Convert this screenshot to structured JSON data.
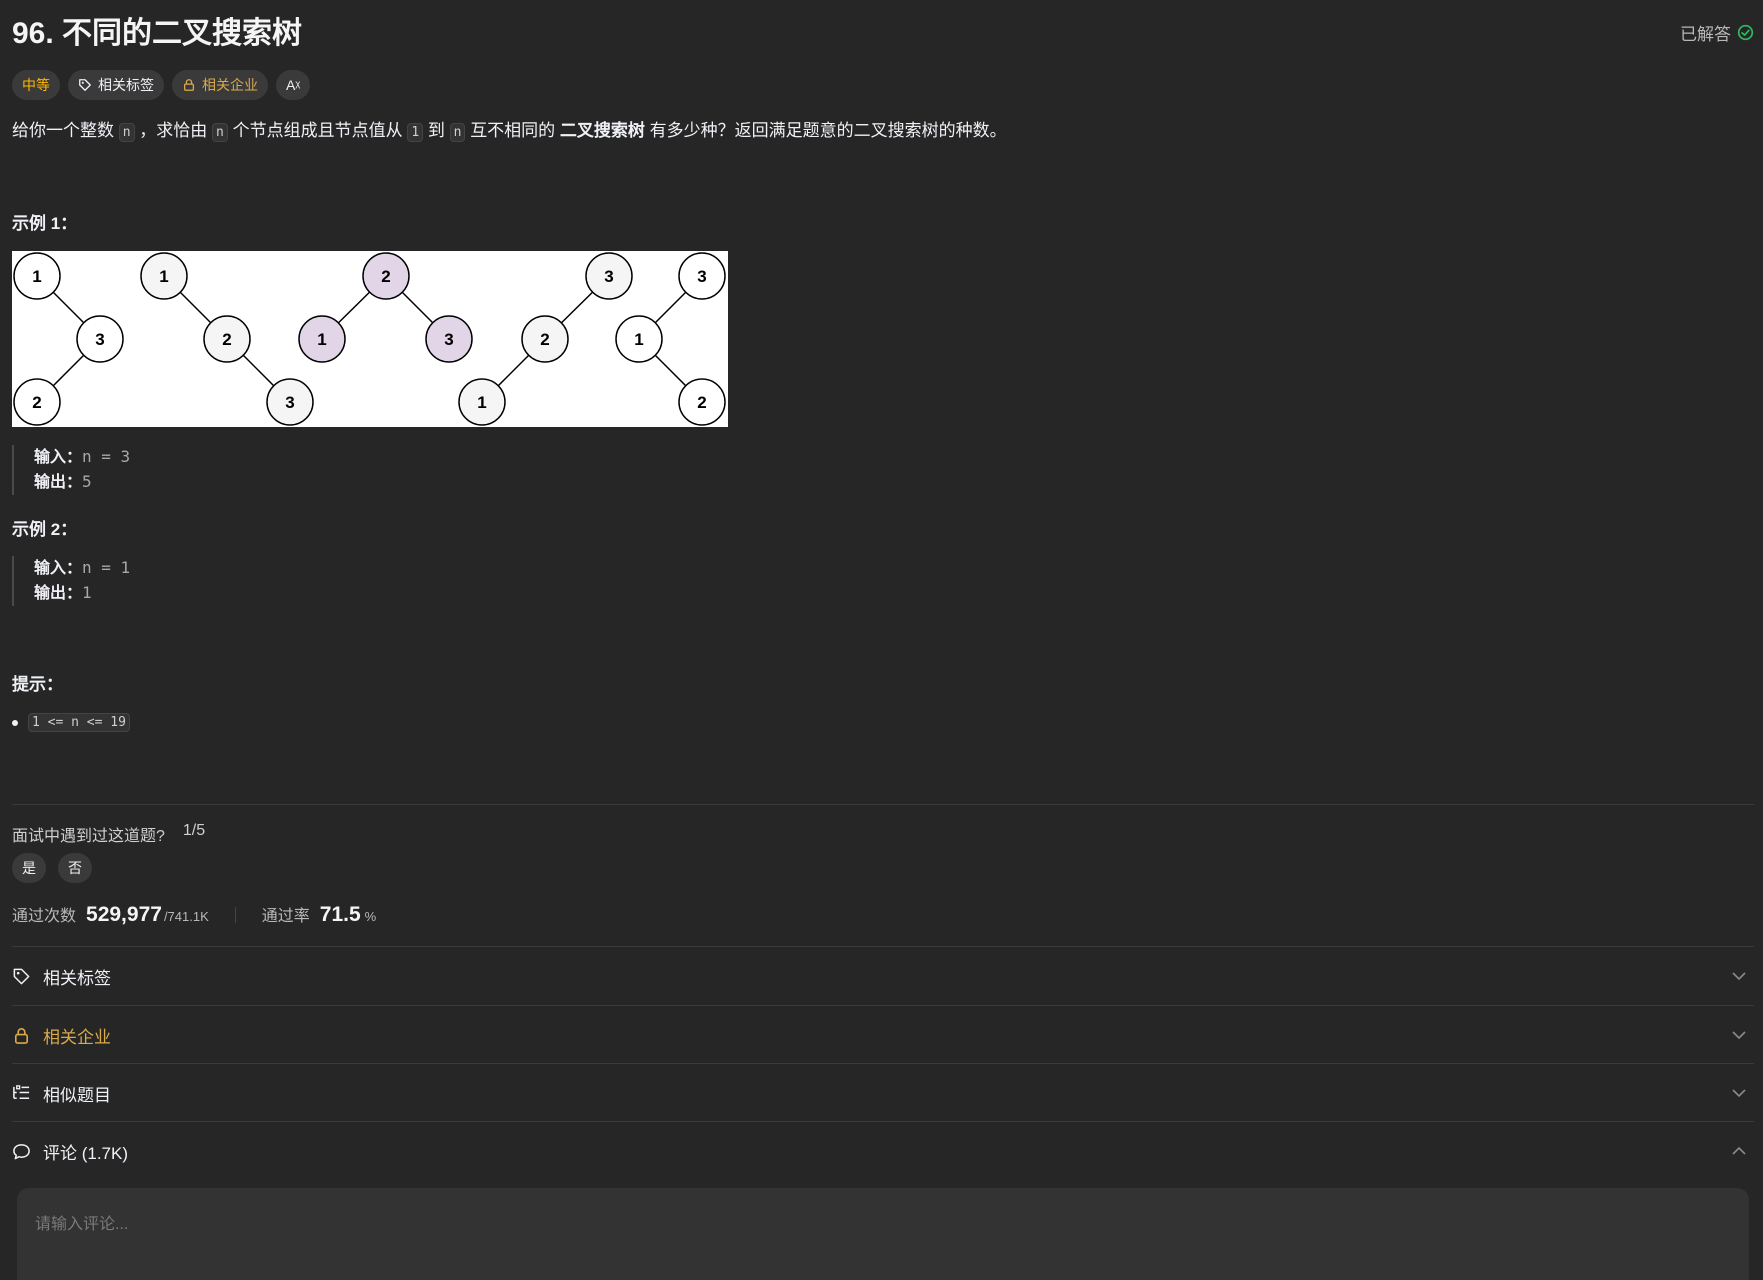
{
  "problem": {
    "title": "96. 不同的二叉搜索树",
    "status": "已解答"
  },
  "tags": {
    "difficulty": "中等",
    "related_tags": "相关标签",
    "related_companies": "相关企业",
    "translate": "Aᵡ"
  },
  "description": {
    "p1": "给你一个整数",
    "code_n": "n",
    "p2": "，求恰由",
    "p3": "个节点组成且节点值从",
    "code_1": "1",
    "p4": "到",
    "p5": "互不相同的",
    "bold": "二叉搜索树",
    "p6": "有多少种？返回满足题意的二叉搜索树的种数。"
  },
  "example1": {
    "title": "示例 1：",
    "input_label": "输入：",
    "input_value": "n = 3",
    "output_label": "输出：",
    "output_value": "5",
    "trees": [
      [
        "1",
        "3",
        "2"
      ],
      [
        "1",
        "2",
        "3"
      ],
      [
        "2",
        "1",
        "3"
      ],
      [
        "3",
        "2",
        "1"
      ],
      [
        "3",
        "1",
        "2"
      ]
    ]
  },
  "example2": {
    "title": "示例 2：",
    "input_label": "输入：",
    "input_value": "n = 1",
    "output_label": "输出：",
    "output_value": "1"
  },
  "hints": {
    "title": "提示：",
    "constraint": "1 <= n <= 19"
  },
  "interview": {
    "question": "面试中遇到过这道题?",
    "count": "1/5",
    "yes": "是",
    "no": "否"
  },
  "stats": {
    "accepted_label": "通过次数",
    "accepted_value": "529,977",
    "submissions": "/741.1K",
    "rate_label": "通过率",
    "rate_value": "71.5",
    "rate_unit": "%"
  },
  "sections": {
    "related_tags": "相关标签",
    "related_companies": "相关企业",
    "similar": "相似题目",
    "comments": "评论 (1.7K)"
  },
  "comment": {
    "placeholder": "请输入评论..."
  },
  "colors": {
    "background": "#262626",
    "difficulty": "#ffb800",
    "company": "#d9a94a",
    "solved_check": "#2cbb5d",
    "highlight_node": "#e1d5e7",
    "plain_node": "#f5f5f5"
  }
}
